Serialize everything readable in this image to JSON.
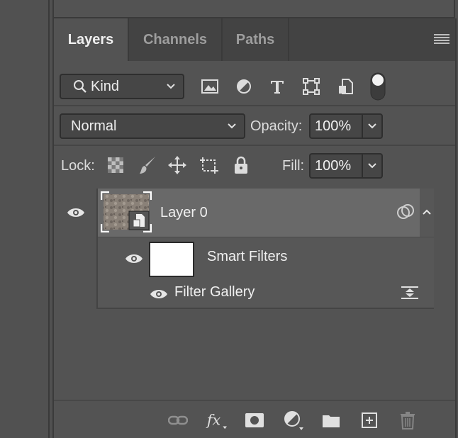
{
  "tabs": [
    {
      "label": "Layers",
      "active": true
    },
    {
      "label": "Channels",
      "active": false
    },
    {
      "label": "Paths",
      "active": false
    }
  ],
  "filter": {
    "kind_label": "Kind"
  },
  "blend": {
    "mode": "Normal",
    "opacity_label": "Opacity:",
    "opacity_value": "100%"
  },
  "lock": {
    "label": "Lock:",
    "fill_label": "Fill:",
    "fill_value": "100%"
  },
  "layers": [
    {
      "name": "Layer 0",
      "type": "smart-object",
      "visible": true,
      "selected": true
    }
  ],
  "smart_filters": {
    "label": "Smart Filters",
    "items": [
      {
        "name": "Filter Gallery",
        "visible": true
      }
    ]
  },
  "colors": {
    "panel": "#535353",
    "selected_row": "#696969",
    "tab_bar": "#434343",
    "field": "#464646"
  }
}
